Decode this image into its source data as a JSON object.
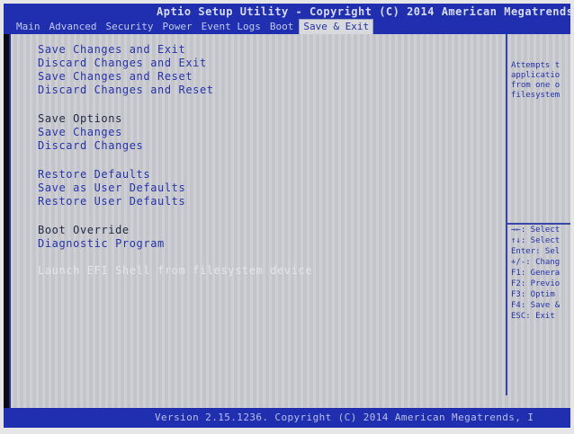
{
  "title": "Aptio Setup Utility - Copyright (C) 2014 American Megatrends",
  "tabs": [
    {
      "label": "Main"
    },
    {
      "label": "Advanced"
    },
    {
      "label": "Security"
    },
    {
      "label": "Power"
    },
    {
      "label": "Event Logs"
    },
    {
      "label": "Boot"
    },
    {
      "label": "Save & Exit",
      "active": true
    }
  ],
  "menu": {
    "save_changes_and_exit": "Save Changes and Exit",
    "discard_changes_and_exit": "Discard Changes and Exit",
    "save_changes_and_reset": "Save Changes and Reset",
    "discard_changes_and_reset": "Discard Changes and Reset",
    "save_options_header": "Save Options",
    "save_changes": "Save Changes",
    "discard_changes": "Discard Changes",
    "restore_defaults": "Restore Defaults",
    "save_as_user_defaults": "Save as User Defaults",
    "restore_user_defaults": "Restore User Defaults",
    "boot_override_header": "Boot Override",
    "diagnostic_program": "Diagnostic Program",
    "launch_efi_shell": "Launch EFI Shell from filesystem device"
  },
  "help": {
    "lines": [
      "Attempts t",
      "applicatio",
      "from one o",
      "filesystem"
    ]
  },
  "keys": [
    "→←: Select",
    "↑↓: Select",
    "Enter: Sel",
    "+/-: Chang",
    "F1: Genera",
    "F2: Previo",
    "F3: Optim",
    "F4: Save &",
    "ESC: Exit"
  ],
  "footer": "Version 2.15.1236. Copyright (C) 2014 American Megatrends, I",
  "colors": {
    "header_blue": "#1f2fb0",
    "body_gray": "#c9cbd0",
    "item_blue": "#2733a8"
  }
}
